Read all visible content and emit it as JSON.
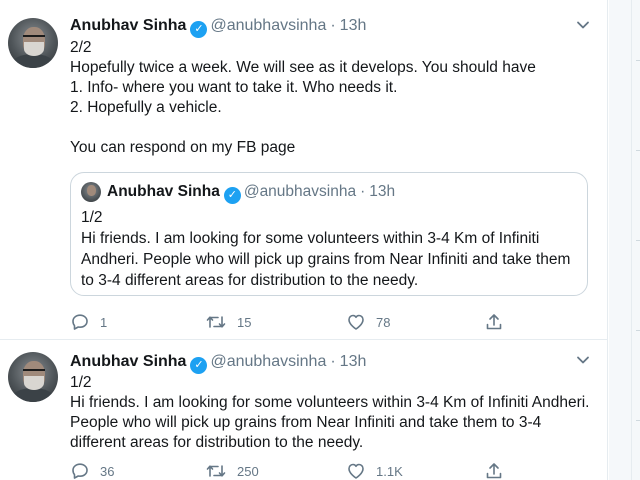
{
  "tweets": [
    {
      "author_name": "Anubhav Sinha",
      "verified_mark": "✓",
      "handle": "@anubhavsinha",
      "separator": "·",
      "time": "13h",
      "lines": [
        "2/2",
        "Hopefully twice a week. We will see as it develops. You should have",
        "1. Info- where you want to take it. Who needs it.",
        "2. Hopefully a vehicle.",
        "",
        "You can respond on my FB page"
      ],
      "quoted": {
        "author_name": "Anubhav Sinha",
        "handle": "@anubhavsinha",
        "separator": "·",
        "time": "13h",
        "lines": [
          "1/2",
          "Hi friends. I am looking for some volunteers within 3-4 Km of Infiniti",
          "Andheri. People who will pick up grains from Near Infiniti and take them",
          "to 3-4 different areas for distribution to the needy."
        ]
      },
      "actions": {
        "replies": "1",
        "retweets": "15",
        "likes": "78"
      }
    },
    {
      "author_name": "Anubhav Sinha",
      "verified_mark": "✓",
      "handle": "@anubhavsinha",
      "separator": "·",
      "time": "13h",
      "lines": [
        "1/2",
        "Hi friends. I am looking for some volunteers within 3-4 Km of Infiniti Andheri.",
        "People who will pick up grains from Near Infiniti and take them to 3-4",
        "different areas for distribution to the needy."
      ],
      "actions": {
        "replies": "36",
        "retweets": "250",
        "likes": "1.1K"
      }
    }
  ],
  "icons": {
    "reply": "speech-bubble",
    "retweet": "retweet-arrows",
    "like": "heart",
    "share": "share-arrow-up",
    "menu": "chevron-down",
    "verified": "verified-badge"
  },
  "colors": {
    "text": "#14171a",
    "secondary": "#657786",
    "verified": "#1da1f2",
    "border": "#e6ecf0"
  }
}
